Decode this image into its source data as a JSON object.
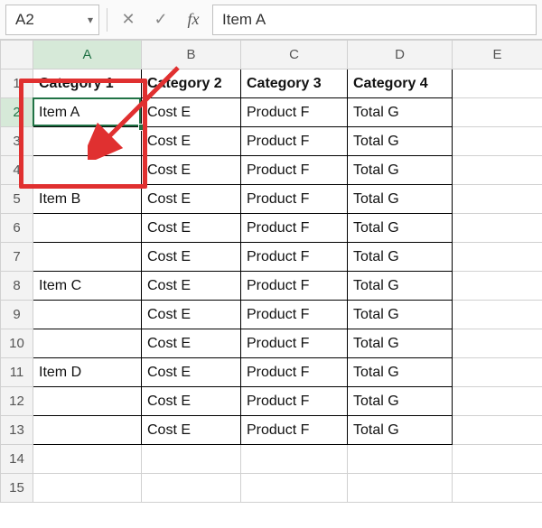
{
  "formulaBar": {
    "nameBox": "A2",
    "cancelGlyph": "✕",
    "confirmGlyph": "✓",
    "fxLabel": "fx",
    "value": "Item A"
  },
  "columns": [
    "A",
    "B",
    "C",
    "D",
    "E"
  ],
  "rowCount": 15,
  "headers": {
    "r1cA": "Category 1",
    "r1cB": "Category 2",
    "r1cC": "Category 3",
    "r1cD": "Category 4"
  },
  "cells": {
    "r2cA": "Item A",
    "r2cB": "Cost E",
    "r2cC": "Product F",
    "r2cD": "Total G",
    "r3cA": "",
    "r3cB": "Cost E",
    "r3cC": "Product F",
    "r3cD": "Total G",
    "r4cA": "",
    "r4cB": "Cost E",
    "r4cC": "Product F",
    "r4cD": "Total G",
    "r5cA": "Item B",
    "r5cB": "Cost E",
    "r5cC": "Product F",
    "r5cD": "Total G",
    "r6cA": "",
    "r6cB": "Cost E",
    "r6cC": "Product F",
    "r6cD": "Total G",
    "r7cA": "",
    "r7cB": "Cost E",
    "r7cC": "Product F",
    "r7cD": "Total G",
    "r8cA": "Item C",
    "r8cB": "Cost E",
    "r8cC": "Product F",
    "r8cD": "Total G",
    "r9cA": "",
    "r9cB": "Cost E",
    "r9cC": "Product F",
    "r9cD": "Total G",
    "r10cA": "",
    "r10cB": "Cost E",
    "r10cC": "Product F",
    "r10cD": "Total G",
    "r11cA": "Item D",
    "r11cB": "Cost E",
    "r11cC": "Product F",
    "r11cD": "Total G",
    "r12cA": "",
    "r12cB": "Cost E",
    "r12cC": "Product F",
    "r12cD": "Total G",
    "r13cA": "",
    "r13cB": "Cost E",
    "r13cC": "Product F",
    "r13cD": "Total G"
  },
  "selection": {
    "cell": "A2",
    "col": "A",
    "row": 2
  }
}
